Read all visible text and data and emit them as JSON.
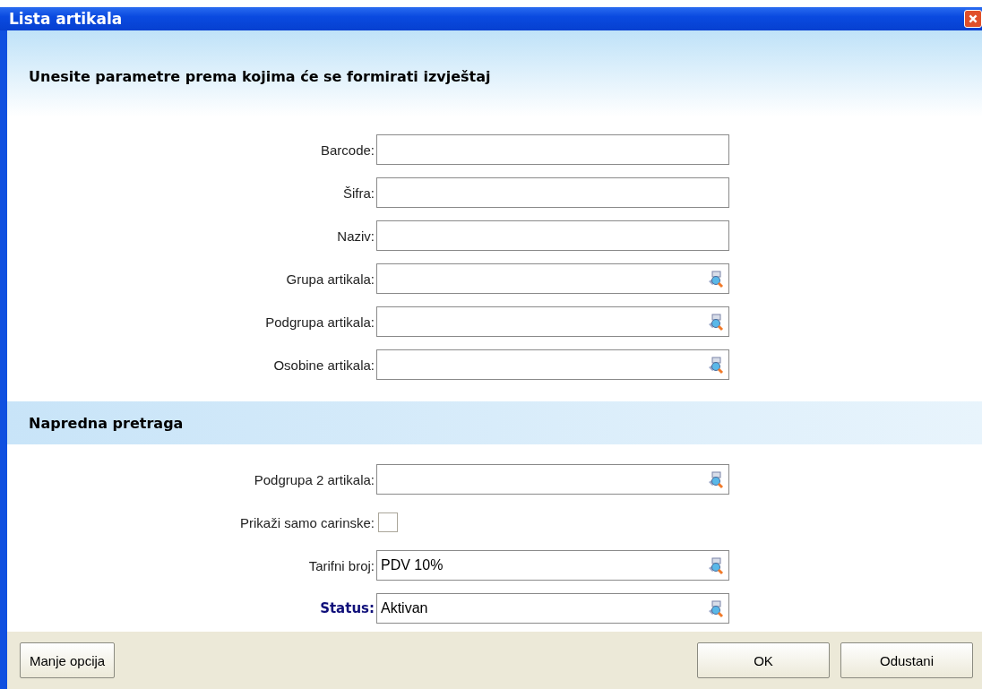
{
  "window": {
    "title": "Lista artikala"
  },
  "header": "Unesite parametre prema kojima će se formirati izvještaj",
  "fields": [
    {
      "label": "Barcode:",
      "kind": "text"
    },
    {
      "label": "Šifra:",
      "kind": "text"
    },
    {
      "label": "Naziv:",
      "kind": "text"
    },
    {
      "label": "Grupa artikala:",
      "kind": "lookup"
    },
    {
      "label": "Podgrupa artikala:",
      "kind": "lookup"
    },
    {
      "label": "Osobine artikala:",
      "kind": "lookup"
    }
  ],
  "advanced": {
    "title": "Napredna pretraga",
    "fields": [
      {
        "label": "Podgrupa 2 artikala:",
        "kind": "lookup"
      },
      {
        "label": "Prikaži samo carinske:",
        "kind": "checkbox",
        "checked": false
      },
      {
        "label": "Tarifni broj:",
        "kind": "lookup",
        "value": "PDV 10%"
      },
      {
        "label": "Status:",
        "kind": "lookup",
        "value": "Aktivan",
        "highlighted": true
      }
    ]
  },
  "buttons": {
    "left": [
      "Manje opcija"
    ],
    "right": [
      "OK",
      "Odustani"
    ]
  }
}
